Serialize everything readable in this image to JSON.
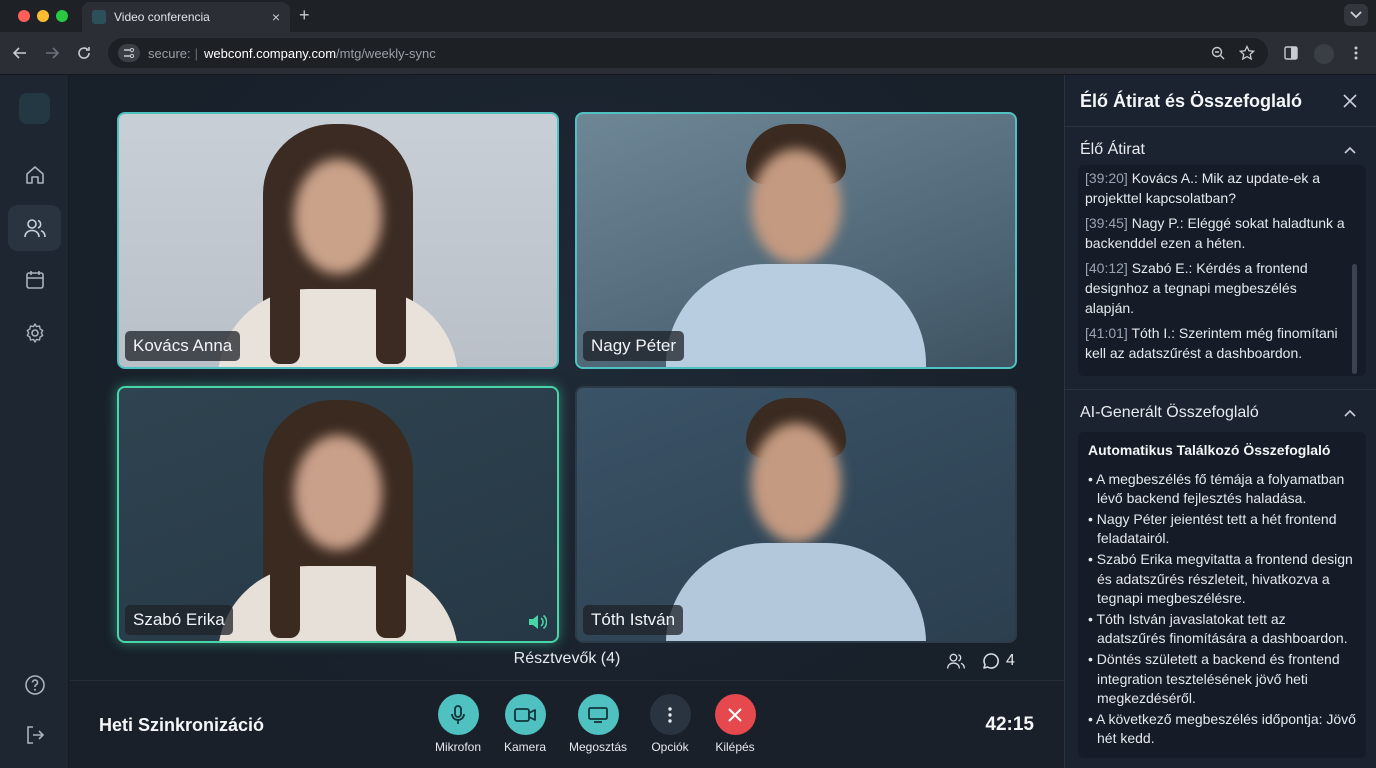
{
  "browser": {
    "tab_title": "Video conferencia",
    "tab_close": "×",
    "new_tab": "+",
    "address": {
      "secure_label": "secure:",
      "separator": "|",
      "host": "webconf.company.com",
      "path": "/mtg/weekly-sync"
    }
  },
  "sidebar": {
    "items": [
      {
        "name": "home",
        "icon": "home-icon"
      },
      {
        "name": "participants",
        "icon": "users-icon",
        "active": true
      },
      {
        "name": "calendar",
        "icon": "calendar-icon"
      },
      {
        "name": "settings",
        "icon": "gear-icon"
      }
    ],
    "bottom": [
      {
        "name": "help",
        "icon": "help-icon"
      },
      {
        "name": "logout",
        "icon": "logout-icon"
      }
    ]
  },
  "tiles": [
    {
      "name": "Kovács Anna",
      "state": "highlighted"
    },
    {
      "name": "Nagy Péter",
      "state": "highlighted"
    },
    {
      "name": "Szabó Erika",
      "state": "speaking"
    },
    {
      "name": "Tóth István",
      "state": "normal"
    }
  ],
  "participants": {
    "label": "Résztvevők (4)",
    "chat_count": "4"
  },
  "controls": {
    "meeting_title": "Heti Szinkronizáció",
    "timer": "42:15",
    "buttons": [
      {
        "label": "Mikrofon",
        "icon": "microphone-icon",
        "color": "#4fc1c0"
      },
      {
        "label": "Kamera",
        "icon": "camera-icon",
        "color": "#4fc1c0"
      },
      {
        "label": "Megosztás",
        "icon": "screen-share-icon",
        "color": "#4fc1c0"
      },
      {
        "label": "Opciók",
        "icon": "more-icon",
        "color": "#2a3441"
      },
      {
        "label": "Kilépés",
        "icon": "close-icon",
        "color": "#e5484d"
      }
    ]
  },
  "panel": {
    "title": "Élő Átirat és Összefoglaló",
    "transcript_section": "Élő Átirat",
    "transcript": [
      {
        "time": "[39:20]",
        "text": "Kovács A.: Mik az update-ek a projekttel kapcsolatban?"
      },
      {
        "time": "[39:45]",
        "text": "Nagy P.: Eléggé sokat haladtunk a backenddel ezen a héten."
      },
      {
        "time": "[40:12]",
        "text": "Szabó E.: Kérdés a frontend designhoz a tegnapi megbeszélés alapján."
      },
      {
        "time": "[41:01]",
        "text": "Tóth I.: Szerintem még finomítani kell az adatszűrést a dashboardon."
      }
    ],
    "summary_section": "AI-Generált Összefoglaló",
    "summary_title": "Automatikus Találkozó Összefoglaló",
    "summary_items": [
      "A megbeszélés fő témája a folyamatban lévő backend fejlesztés haladása.",
      "Nagy Péter jeientést tett a hét frontend feladatairól.",
      "Szabó Erika megvitatta a frontend design és adatszűrés részleteit, hivatkozva a tegnapi megbeszélésre.",
      "Tóth István javaslatokat tett az adatszűrés finomítására a dashboardon.",
      "Döntés született a backend és frontend integration tesztelésének jövő heti megkezdéséről.",
      "A következő megbeszélés időpontja: Jövő hét kedd."
    ]
  },
  "colors": {
    "accent": "#4fc1c0",
    "speaking": "#48d6a8",
    "danger": "#e5484d"
  }
}
